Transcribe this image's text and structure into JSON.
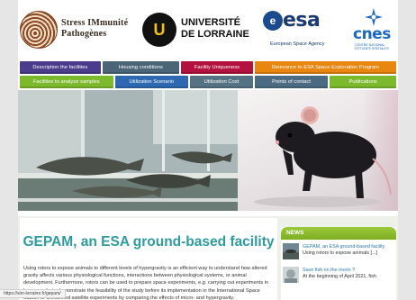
{
  "colors": {
    "nav_purple": "#4b3c8c",
    "nav_slate": "#4a6478",
    "nav_crimson": "#b3123e",
    "nav_orange": "#e8860f",
    "nav_green": "#7cb92c",
    "nav_blue": "#2e68b0",
    "nav_steel": "#557184",
    "title_teal": "#2e9c9f",
    "news_green": "#8cbf2c"
  },
  "logos": {
    "sim": {
      "line1": "Stress IMmunité",
      "line2": "Pathogènes"
    },
    "ul": {
      "monogram": "U",
      "line1": "UNIVERSITÉ",
      "line2": "DE LORRAINE"
    },
    "esa": {
      "mark": "e",
      "word": "esa",
      "sub": "European Space Agency"
    },
    "cnes": {
      "word": "cnes",
      "sub": "Centre national d'études spatiales"
    }
  },
  "nav": {
    "row1": [
      {
        "label": "Description the facilities",
        "color": "#4b3c8c"
      },
      {
        "label": "Housing conditions",
        "color": "#4a6478"
      },
      {
        "label": "Facility Uniqueness",
        "color": "#b3123e"
      },
      {
        "label": "Relevance to ESA Space Exploration Program",
        "color": "#e8860f"
      }
    ],
    "row2": [
      {
        "label": "Facilities to analyze samples",
        "color": "#7cb92c"
      },
      {
        "label": "Utilization Scenario",
        "color": "#2e68b0"
      },
      {
        "label": "Utilization Cost",
        "color": "#557184"
      },
      {
        "label": "Points of contact",
        "color": "#4b6b82"
      },
      {
        "label": "Publications",
        "color": "#7cb92c"
      }
    ]
  },
  "main": {
    "title": "GEPAM, an ESA ground-based facility",
    "body": "Using rotors to expose animals to different levels of hypergravity is an efficient way to understand how altered gravity affects various physiological functions, interactions between physiological systems, or animal development. Furthermore, rotors can be used to prepare space experiments, e.g. carrying out experiments in hypergravity to demonstrate the feasibility of the study before its implementation in the International Space Station or unmanned satellite experiments by comparing the effects of micro- and hypergravity."
  },
  "news": {
    "header": "NEWS",
    "items": [
      {
        "title": "GEPAM, an ESA ground-based facility",
        "snippet": "Using rotors to expose animals [...]"
      },
      {
        "title": "Save fish on the moon ?",
        "snippet": "At the beginning of April 2021, fish"
      }
    ]
  },
  "status_bar": {
    "url": "https://sim-lorraine.fr/gepam/"
  }
}
